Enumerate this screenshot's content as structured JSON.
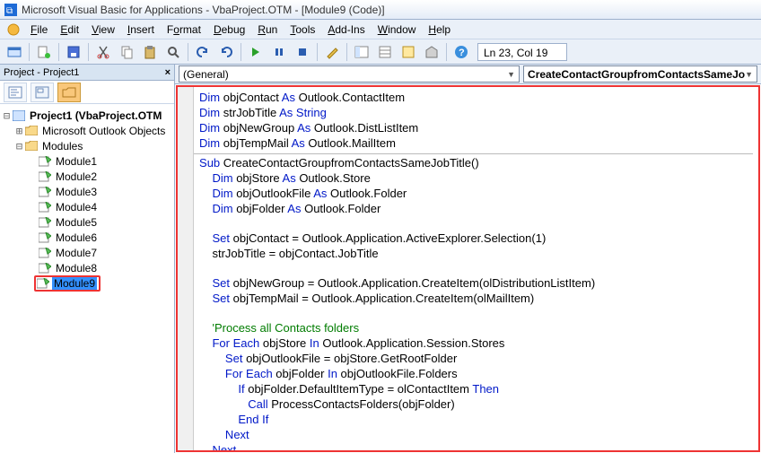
{
  "title": "Microsoft Visual Basic for Applications - VbaProject.OTM - [Module9 (Code)]",
  "menus": {
    "file": "File",
    "edit": "Edit",
    "view": "View",
    "insert": "Insert",
    "format": "Format",
    "debug": "Debug",
    "run": "Run",
    "tools": "Tools",
    "addins": "Add-Ins",
    "window": "Window",
    "help": "Help"
  },
  "status": "Ln 23, Col 19",
  "project": {
    "panel_title": "Project - Project1",
    "root": "Project1 (VbaProject.OTM",
    "folder1": "Microsoft Outlook Objects",
    "folder2": "Modules",
    "modules": [
      "Module1",
      "Module2",
      "Module3",
      "Module4",
      "Module5",
      "Module6",
      "Module7",
      "Module8",
      "Module9"
    ]
  },
  "combos": {
    "left": "(General)",
    "right": "CreateContactGroupfromContactsSameJo"
  },
  "code": {
    "l01a": "Dim",
    "l01b": " objContact ",
    "l01c": "As",
    "l01d": " Outlook.ContactItem",
    "l02a": "Dim",
    "l02b": " strJobTitle ",
    "l02c": "As",
    "l02d": " String",
    "l03a": "Dim",
    "l03b": " objNewGroup ",
    "l03c": "As",
    "l03d": " Outlook.DistListItem",
    "l04a": "Dim",
    "l04b": " objTempMail ",
    "l04c": "As",
    "l04d": " Outlook.MailItem",
    "l06a": "Sub",
    "l06b": " CreateContactGroupfromContactsSameJobTitle()",
    "l07a": "    Dim",
    "l07b": " objStore ",
    "l07c": "As",
    "l07d": " Outlook.Store",
    "l08a": "    Dim",
    "l08b": " objOutlookFile ",
    "l08c": "As",
    "l08d": " Outlook.Folder",
    "l09a": "    Dim",
    "l09b": " objFolder ",
    "l09c": "As",
    "l09d": " Outlook.Folder",
    "l11a": "    Set",
    "l11b": " objContact = Outlook.Application.ActiveExplorer.Selection(1)",
    "l12": "    strJobTitle = objContact.JobTitle",
    "l14a": "    Set",
    "l14b": " objNewGroup = Outlook.Application.CreateItem(olDistributionListItem)",
    "l15a": "    Set",
    "l15b": " objTempMail = Outlook.Application.CreateItem(olMailItem)",
    "l17": "    'Process all Contacts folders",
    "l18a": "    For Each",
    "l18b": " objStore ",
    "l18c": "In",
    "l18d": " Outlook.Application.Session.Stores",
    "l19a": "        Set",
    "l19b": " objOutlookFile = objStore.GetRootFolder",
    "l20a": "        For Each",
    "l20b": " objFolder ",
    "l20c": "In",
    "l20d": " objOutlookFile.Folders",
    "l21a": "            If",
    "l21b": " objFolder.DefaultItemType = olContactItem ",
    "l21c": "Then",
    "l22a": "               Call",
    "l22b": " ProcessContactsFolders(objFolder)",
    "l23": "            End If",
    "l24": "        Next",
    "l25": "    Next"
  }
}
